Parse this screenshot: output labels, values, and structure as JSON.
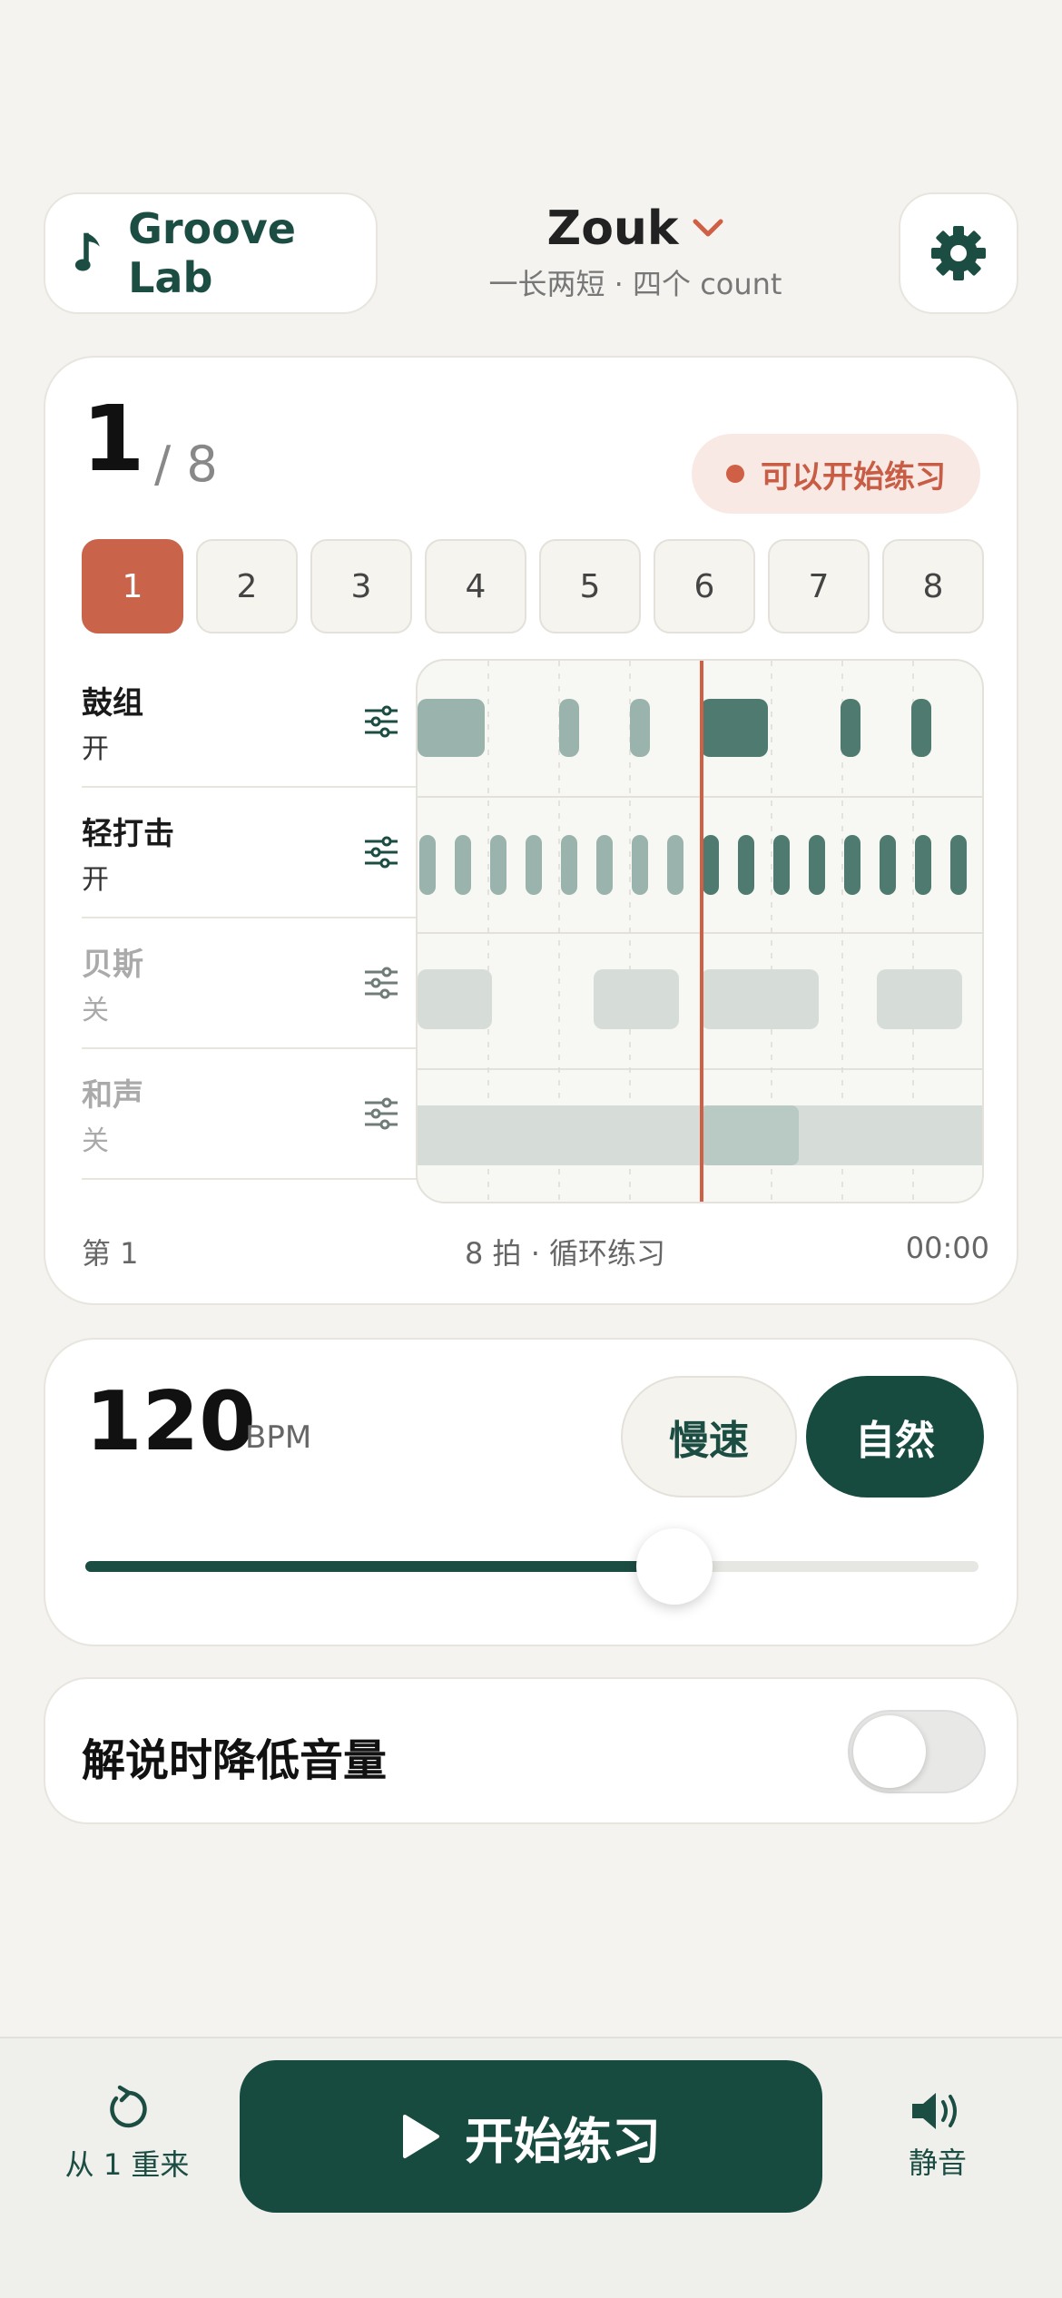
{
  "header": {
    "app_name": "Groove Lab",
    "style_title": "Zouk",
    "style_subtitle": "一长两短 · 四个 count"
  },
  "main": {
    "current_count": "1",
    "total_count": "/ 8",
    "status": "可以开始练习",
    "beats": [
      "1",
      "2",
      "3",
      "4",
      "5",
      "6",
      "7",
      "8"
    ],
    "active_beat": 1,
    "tracks": [
      {
        "name": "鼓组",
        "state": "开",
        "enabled": true
      },
      {
        "name": "轻打击",
        "state": "开",
        "enabled": true
      },
      {
        "name": "贝斯",
        "state": "关",
        "enabled": false
      },
      {
        "name": "和声",
        "state": "关",
        "enabled": false
      }
    ],
    "footer_left": "第  1",
    "footer_mid": "8 拍 · 循环练习",
    "footer_right": "00:00",
    "playhead_fraction": 0.5
  },
  "tempo": {
    "bpm": "120",
    "unit": "BPM",
    "mode_slow": "慢速",
    "mode_natural": "自然",
    "slider_fraction": 0.66
  },
  "duck": {
    "label": "解说时降低音量",
    "enabled": false
  },
  "bottom": {
    "restart_label": "从 1 重来",
    "play_label": "开始练习",
    "mute_label": "静音"
  },
  "colors": {
    "accent": "#c9644b",
    "primary": "#174b40",
    "background": "#f4f3ef"
  }
}
